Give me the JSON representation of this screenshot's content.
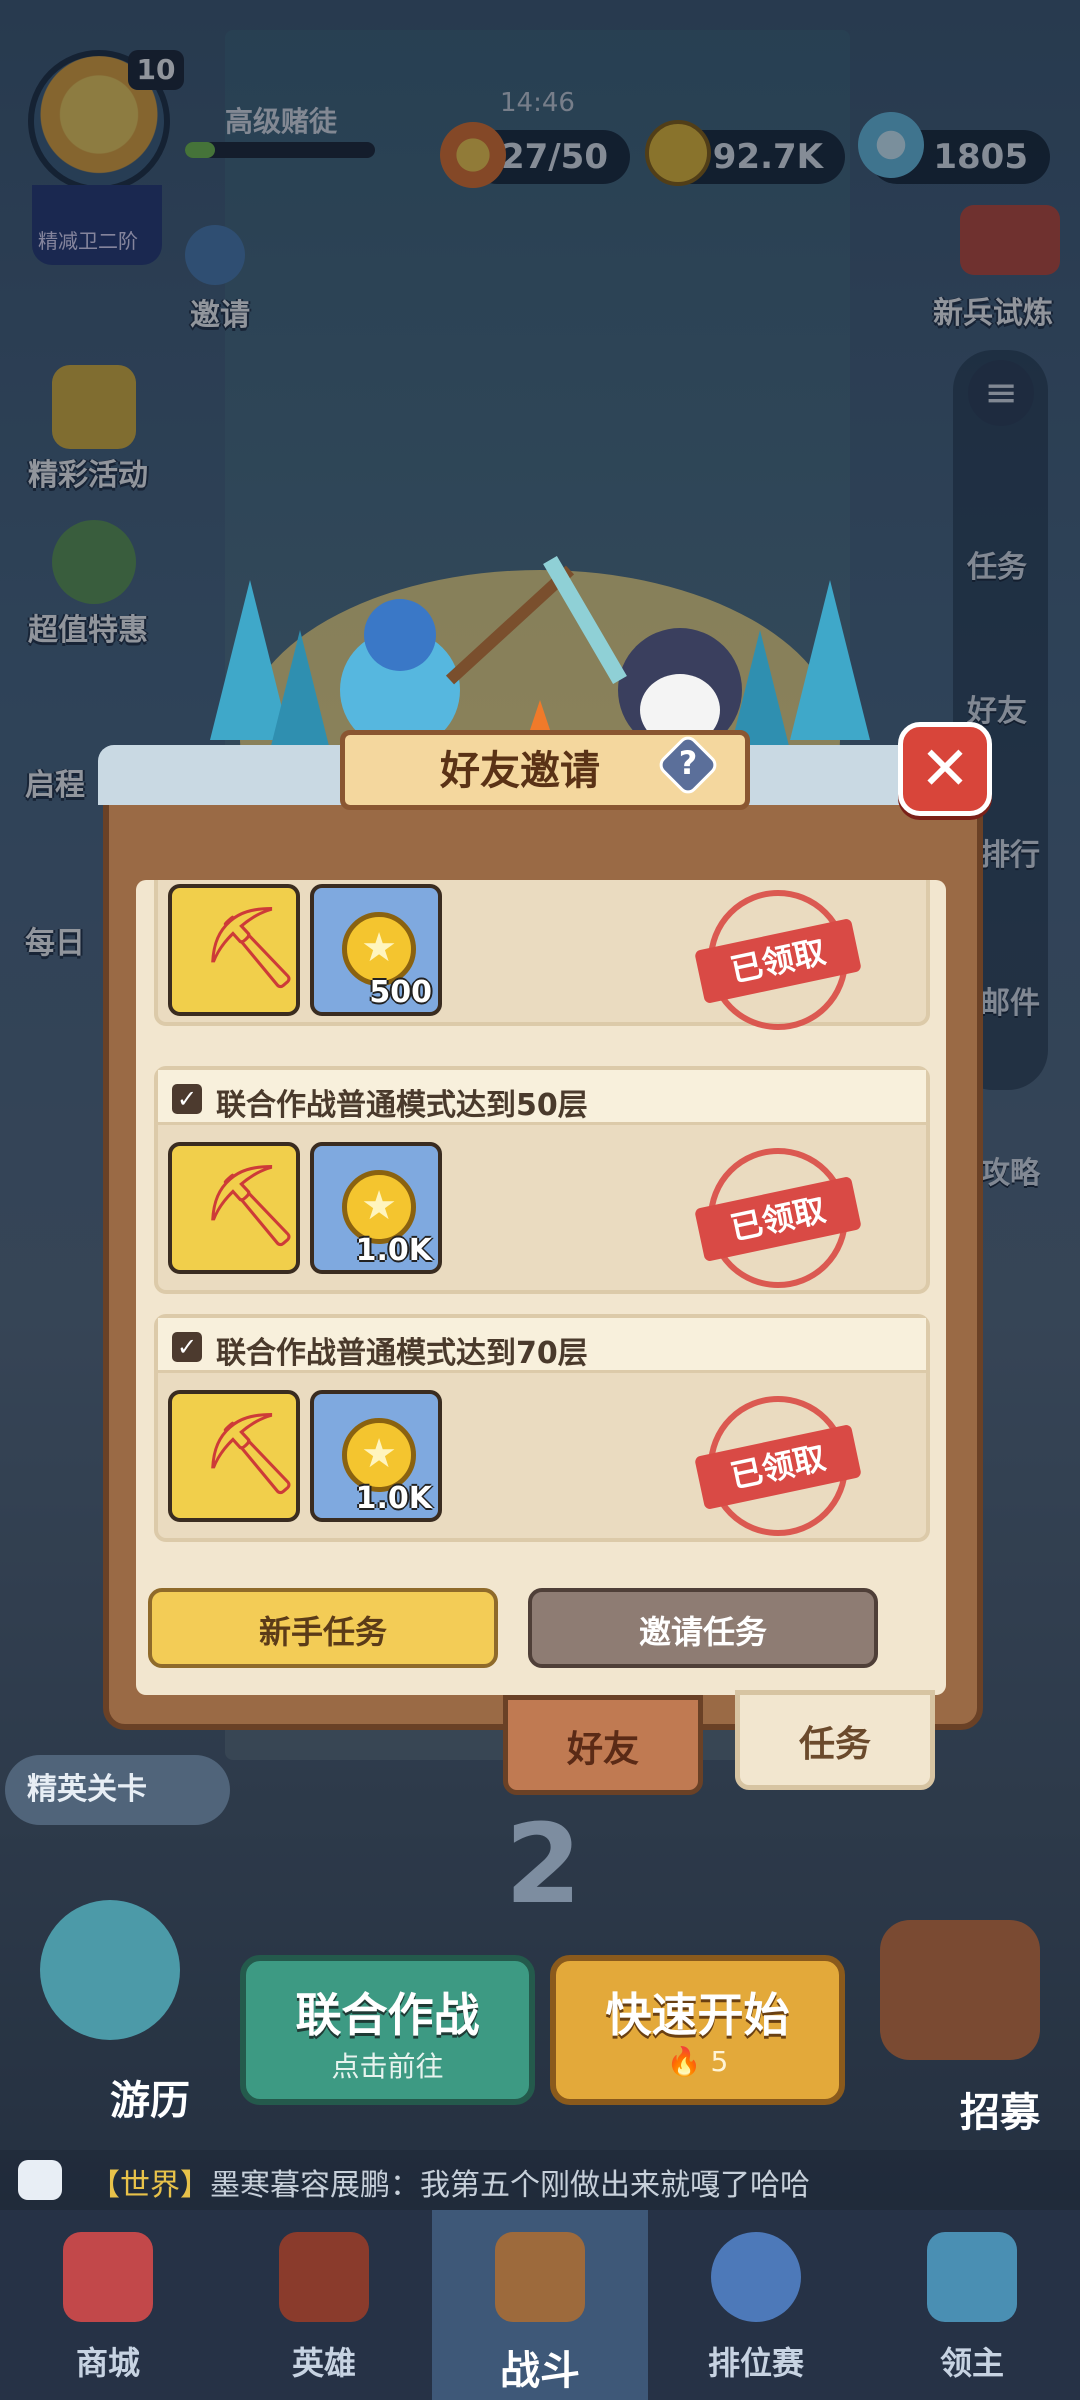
{
  "top_bar": {
    "player_level": "10",
    "rank_text": "精减卫二阶",
    "title": "高级赌徒",
    "timer": "14:46",
    "energy": "27/50",
    "gold": "92.7K",
    "gems": "1805",
    "help_symbol": "?"
  },
  "left_menu": [
    {
      "label": "邀请"
    },
    {
      "label": "精彩活动"
    },
    {
      "label": "超值特惠"
    },
    {
      "label": "启程"
    },
    {
      "label": "每日"
    }
  ],
  "right_menu": {
    "event_label": "新兵试炼",
    "items": [
      {
        "label": "任务"
      },
      {
        "label": "好友"
      },
      {
        "label": "排行"
      },
      {
        "label": "邮件"
      },
      {
        "label": "攻略"
      }
    ]
  },
  "dialog": {
    "title": "好友邀请",
    "help_symbol": "?",
    "close_symbol": "✕",
    "tasks": [
      {
        "text": "",
        "rewards": [
          "",
          "500"
        ],
        "status": "已领取"
      },
      {
        "text": "联合作战普通模式达到50层",
        "rewards": [
          "",
          "1.0K"
        ],
        "status": "已领取"
      },
      {
        "text": "联合作战普通模式达到70层",
        "rewards": [
          "",
          "1.0K"
        ],
        "status": "已领取"
      }
    ],
    "sub_tabs": [
      {
        "label": "新手任务",
        "active": true
      },
      {
        "label": "邀请任务",
        "active": false
      }
    ],
    "bottom_tabs": [
      {
        "label": "好友",
        "active": false
      },
      {
        "label": "任务",
        "active": true
      }
    ]
  },
  "lower": {
    "elite_stage": "精英关卡",
    "stage_number": "2",
    "travel_label": "游历",
    "recruit_label": "招募",
    "coop_button": {
      "title": "联合作战",
      "subtitle": "点击前往"
    },
    "quick_start_button": {
      "title": "快速开始",
      "cost": "5"
    }
  },
  "chat": {
    "channel": "【世界】",
    "message": "墨寒暮容展鹏：我第五个刚做出来就嘎了哈哈"
  },
  "navbar": [
    {
      "label": "商城",
      "active": false
    },
    {
      "label": "英雄",
      "active": false
    },
    {
      "label": "战斗",
      "active": true
    },
    {
      "label": "排位赛",
      "active": false
    },
    {
      "label": "领主",
      "active": false
    }
  ],
  "colors": {
    "accent_gold": "#f3cc56",
    "close_red": "#d8453a",
    "claimed_red": "#d94a45",
    "panel_cream": "#f2e6cf"
  }
}
